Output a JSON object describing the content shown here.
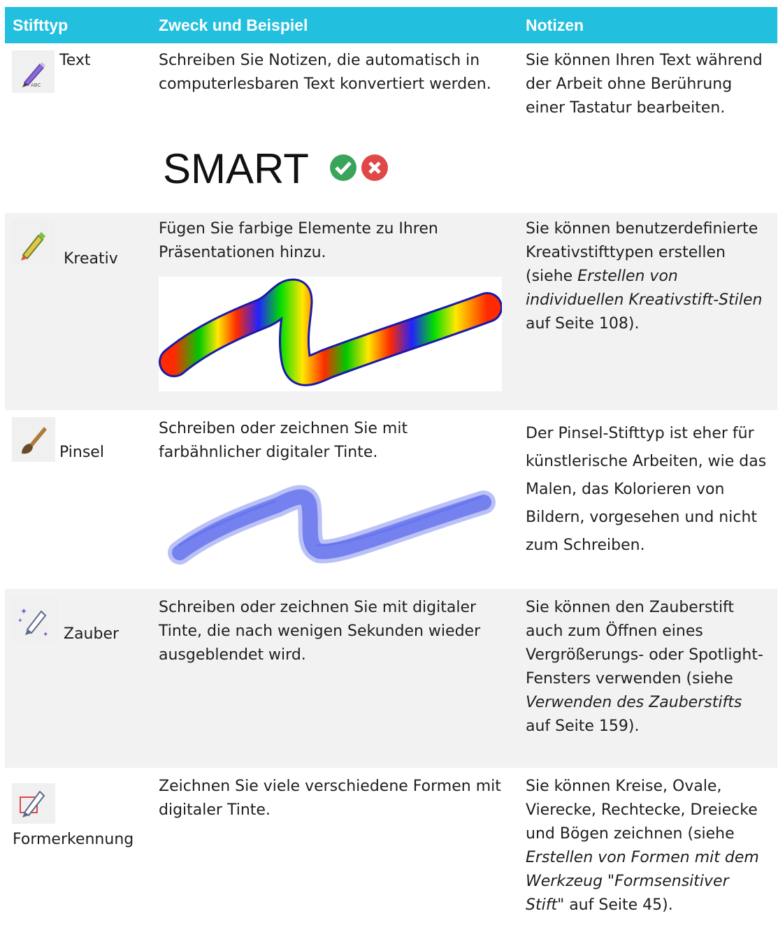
{
  "header": {
    "col1": "Stifttyp",
    "col2": "Zweck und Beispiel",
    "col3": "Notizen"
  },
  "rows": [
    {
      "name": "Text",
      "icon": "text-pen-icon",
      "purpose": "Schreiben Sie Notizen, die automatisch in computerlesbaren Text konvertiert werden.",
      "example": {
        "word": "SMART",
        "check_color": "#3aa55a",
        "x_color": "#e04848"
      },
      "notes": [
        "Sie können Ihren Text während der Arbeit ohne Berührung einer Tastatur bearbeiten."
      ]
    },
    {
      "name": "Kreativ",
      "icon": "creative-pen-icon",
      "purpose": "Fügen Sie farbige Elemente zu Ihren Präsentationen hinzu.",
      "notes": [
        "Sie können benutzerdefinierte Kreativstifttypen erstellen (siehe ",
        "Erstellen von individuellen Kreativstift-Stilen",
        " auf Seite 108)."
      ]
    },
    {
      "name": "Pinsel",
      "icon": "brush-icon",
      "purpose": "Schreiben oder zeichnen Sie mit farbähnlicher digitaler Tinte.",
      "notes": [
        "Der Pinsel-Stifttyp ist eher für künstlerische Arbeiten, wie das Malen, das Kolorieren von Bildern, vorgesehen und nicht zum Schreiben."
      ]
    },
    {
      "name": "Zauber",
      "icon": "magic-pen-icon",
      "purpose": "Schreiben oder zeichnen Sie mit digitaler Tinte, die nach wenigen Sekunden wieder ausgeblendet wird.",
      "notes": [
        "Sie können den Zauberstift auch zum Öffnen eines Vergrößerungs- oder Spotlight-Fensters verwenden (siehe ",
        "Verwenden des Zauberstifts",
        " auf Seite 159)."
      ]
    },
    {
      "name": "Formerkennung",
      "icon": "shape-recognition-pen-icon",
      "purpose": "Zeichnen Sie viele verschiedene Formen mit digitaler Tinte.",
      "notes": [
        "Sie können Kreise, Ovale, Vierecke, Rechtecke, Dreiecke und Bögen zeichnen (siehe ",
        "Erstellen von Formen mit dem Werkzeug \"Formsensitiver Stift\"",
        " auf Seite 45)."
      ]
    }
  ],
  "colors": {
    "header_bg": "#23bfde",
    "alt_row_bg": "#f2f2f2",
    "brush_ink": "#3a4de8"
  }
}
